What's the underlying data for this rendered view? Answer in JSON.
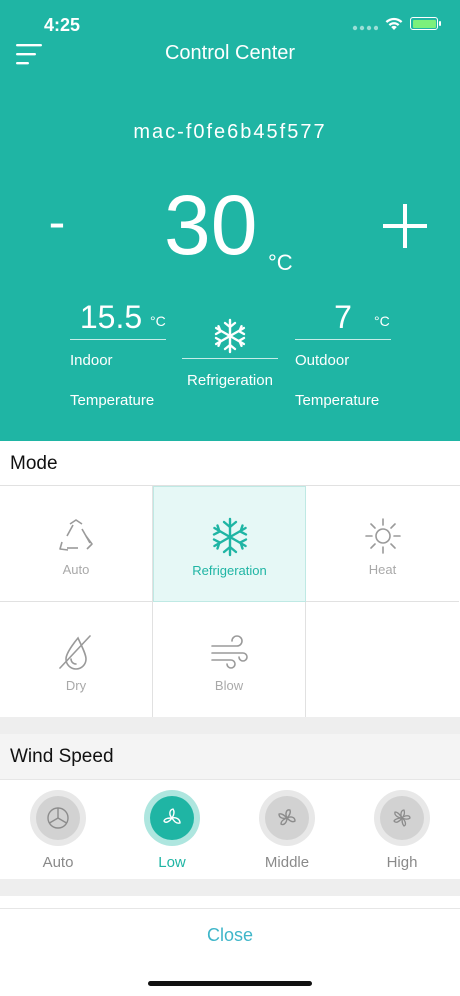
{
  "status_bar": {
    "time": "4:25"
  },
  "header": {
    "title": "Control Center",
    "device_id": "mac-f0fe6b45f577"
  },
  "thermostat": {
    "minus_label": "-",
    "set_temp": "30",
    "unit": "°C",
    "indoor_value": "15.5",
    "indoor_unit": "°C",
    "indoor_label_1": "Indoor",
    "indoor_label_2": "Temperature",
    "current_mode": "Refrigeration",
    "outdoor_value": "7",
    "outdoor_unit": "°C",
    "outdoor_label_1": "Outdoor",
    "outdoor_label_2": "Temperature"
  },
  "mode": {
    "title": "Mode",
    "items": [
      {
        "label": "Auto",
        "icon": "recycle-icon"
      },
      {
        "label": "Refrigeration",
        "icon": "snowflake-icon",
        "active": true
      },
      {
        "label": "Heat",
        "icon": "sun-icon"
      },
      {
        "label": "Dry",
        "icon": "dry-icon"
      },
      {
        "label": "Blow",
        "icon": "wind-icon"
      }
    ]
  },
  "wind": {
    "title": "Wind Speed",
    "items": [
      {
        "label": "Auto",
        "icon": "fan-icon"
      },
      {
        "label": "Low",
        "icon": "fan-icon",
        "active": true
      },
      {
        "label": "Middle",
        "icon": "fan-icon"
      },
      {
        "label": "High",
        "icon": "fan-icon"
      }
    ]
  },
  "footer": {
    "close_label": "Close"
  },
  "colors": {
    "accent": "#1fb5a4",
    "close_text": "#3fb6c9",
    "inactive_text": "#a9a9a9"
  }
}
